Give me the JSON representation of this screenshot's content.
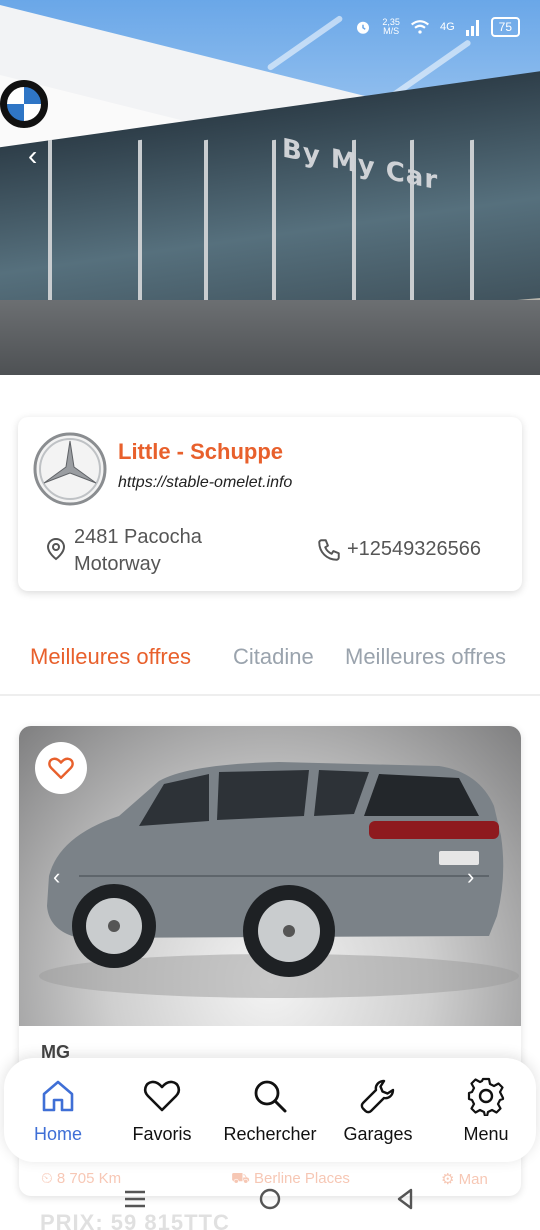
{
  "status_bar": {
    "speed": "2,35",
    "speed_unit": "M/S",
    "network": "4G",
    "battery": "75",
    "icons": [
      "alarm-icon",
      "wifi-icon",
      "signal-icon",
      "battery-icon"
    ]
  },
  "hero": {
    "storefront_sign": "By My Car",
    "icons": [
      "back-chevron-icon",
      "bmw-logo"
    ]
  },
  "dealer": {
    "name": "Little - Schuppe",
    "url": "https://stable-omelet.info",
    "address": "2481 Pacocha Motorway",
    "phone": "+12549326566",
    "logo": "mercedes-logo"
  },
  "tabs": [
    {
      "label": "Meilleures offres",
      "active": true
    },
    {
      "label": "Citadine",
      "active": false
    },
    {
      "label": "Meilleures offres",
      "active": false
    }
  ],
  "listing": {
    "brand": "MG",
    "mileage": "8 705 Km",
    "body": "Berline Places",
    "transmission": "Man",
    "price": "PRIX: 59 815TTC",
    "favorite_icon": "heart-outline-icon"
  },
  "bottom_nav": [
    {
      "label": "Home",
      "icon": "home-icon",
      "active": true
    },
    {
      "label": "Favoris",
      "icon": "heart-icon",
      "active": false
    },
    {
      "label": "Rechercher",
      "icon": "search-icon",
      "active": false
    },
    {
      "label": "Garages",
      "icon": "wrench-icon",
      "active": false
    },
    {
      "label": "Menu",
      "icon": "gear-icon",
      "active": false
    }
  ],
  "colors": {
    "accent": "#e8602c",
    "nav_active": "#3f6fd6",
    "tab_inactive": "#9aa3ad"
  }
}
